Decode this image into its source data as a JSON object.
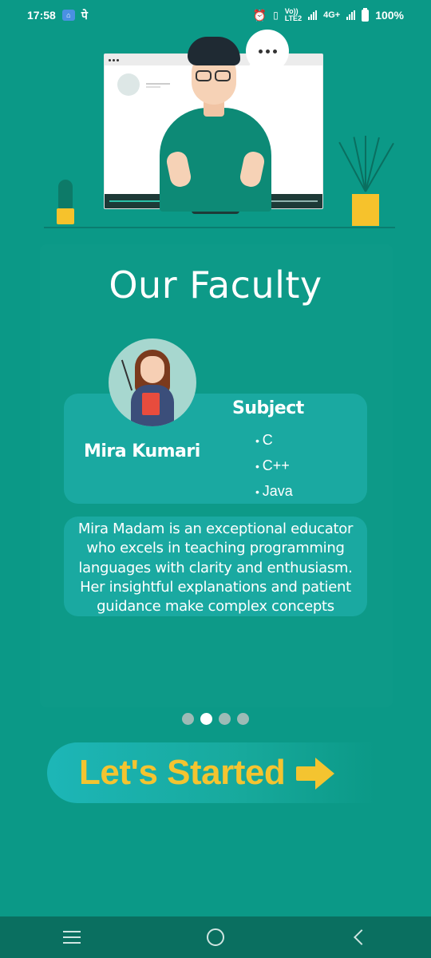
{
  "status_bar": {
    "time": "17:58",
    "app_glyph": "पे",
    "network_label": "4G+",
    "volte_top": "Vo))",
    "volte_bottom": "LTE2",
    "battery": "100%"
  },
  "page": {
    "title": "Our Faculty",
    "faculty": {
      "name": "Mira Kumari",
      "subject_heading": "Subject",
      "subjects": [
        "C",
        "C++",
        "Java"
      ],
      "description": "Mira Madam is an exceptional educator who excels in teaching programming languages with clarity and enthusiasm. Her insightful explanations and patient guidance make complex concepts"
    },
    "pager": {
      "count": 4,
      "active_index": 1
    }
  },
  "cta": {
    "label": "Let's Started",
    "icon": "arrow-right-icon"
  },
  "nav_bar": {
    "icons": [
      "menu-icon",
      "home-icon",
      "back-icon"
    ]
  },
  "colors": {
    "background": "#0b9987",
    "card": "#1aa9a1",
    "accent": "#f4c430",
    "nav": "#0a6f60"
  }
}
